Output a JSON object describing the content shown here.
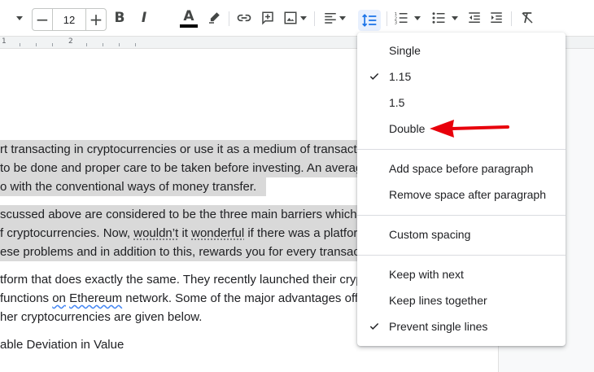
{
  "toolbar": {
    "font_size": {
      "decrease_label": "−",
      "value": "12",
      "increase_label": "+"
    },
    "bold_label": "B",
    "italic_label": "I",
    "text_color_label": "A",
    "icons": [
      "dropdown-caret",
      "bold-icon",
      "italic-icon",
      "text-color-icon",
      "highlight-icon",
      "link-icon",
      "comment-icon",
      "image-icon",
      "align-icon",
      "line-spacing-icon",
      "numbered-list-icon",
      "bulleted-list-icon",
      "decrease-indent-icon",
      "increase-indent-icon",
      "clear-formatting-icon"
    ],
    "text_color_swatch": "#000000"
  },
  "ruler": {
    "numbers": [
      "1",
      "2"
    ]
  },
  "document": {
    "lines": [
      {
        "text": "rt transacting in cryptocurrencies or use it as a medium of transactio",
        "highlighted": true
      },
      {
        "text": " to be done and proper care to be taken before investing. An average",
        "highlighted": true
      },
      {
        "text": "o with the conventional ways of money transfer.",
        "highlighted": true
      },
      {
        "text": "scussed above are considered to be the three main barriers which re",
        "highlighted": true
      },
      {
        "text_before": "f cryptocurrencies. Now, ",
        "wouldnt": "wouldn’t",
        "text_mid": " it ",
        "wonderful": "wonderful",
        "text_after": " if there was a platfor",
        "highlighted": true
      },
      {
        "text": "ese problems and in addition to this, rewards you for every transactio",
        "highlighted": true
      },
      {
        "text": "tform that does exactly the same. They recently launched their crypt",
        "highlighted": false
      },
      {
        "text_before": " functions ",
        "on": "on",
        "text_mid": " ",
        "ethereum": "Ethereum",
        "text_after": " network. Some of the major advantages offe",
        "highlighted": false
      },
      {
        "text": "her cryptocurrencies are given below.",
        "highlighted": false
      },
      {
        "text": "able Deviation in Value",
        "highlighted": false
      }
    ]
  },
  "line_spacing_menu": {
    "items": [
      {
        "label": "Single",
        "checked": false
      },
      {
        "label": "1.15",
        "checked": true
      },
      {
        "label": "1.5",
        "checked": false
      },
      {
        "label": "Double",
        "checked": false
      }
    ],
    "paragraph_items": [
      {
        "label": "Add space before paragraph"
      },
      {
        "label": "Remove space after paragraph"
      }
    ],
    "custom_spacing_label": "Custom spacing",
    "keep_items": [
      {
        "label": "Keep with next",
        "checked": false
      },
      {
        "label": "Keep lines together",
        "checked": false
      },
      {
        "label": "Prevent single lines",
        "checked": true
      }
    ]
  },
  "annotation": {
    "arrow_color": "#e8000b",
    "points_to": "Double"
  },
  "colors": {
    "highlight": "#d9d9d9",
    "active_button_bg": "#e8f0fe",
    "active_icon": "#1a73e8"
  }
}
